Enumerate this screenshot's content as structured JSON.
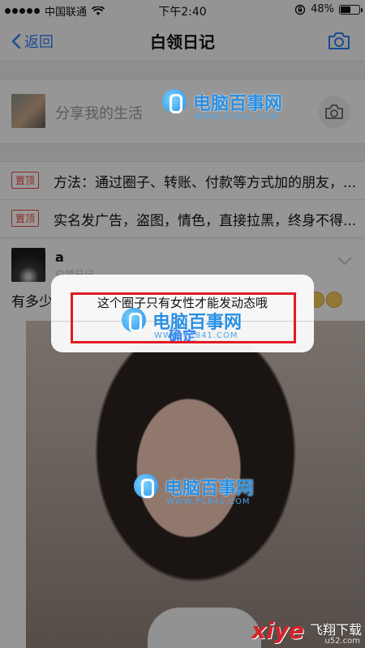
{
  "status_bar": {
    "carrier": "中国联通",
    "time": "下午2:40",
    "battery": "48%",
    "battery_level": 0.48
  },
  "nav": {
    "back_label": "返回",
    "title": "白领日记",
    "camera_icon": "camera-icon"
  },
  "share": {
    "placeholder": "分享我的生活",
    "camera_icon": "camera-icon"
  },
  "pinned": [
    {
      "badge": "置顶",
      "text": "方法：通过圈子、转账、付款等方式加的朋友，..."
    },
    {
      "badge": "置顶",
      "text": "实名发广告，盗图，情色，直接拉黑，终身不得..."
    }
  ],
  "post": {
    "author": "a",
    "subtitle": "白领日记",
    "text": "有多少"
  },
  "alert": {
    "message": "这个圈子只有女性才能发动态哦",
    "confirm_label": "确定"
  },
  "watermark": {
    "title": "电脑百事网",
    "url": "WWW.PC841.COM"
  },
  "bottom_watermark": {
    "brand": "xiye",
    "text": "飞翔下载",
    "url": "u52.com"
  },
  "colors": {
    "accent": "#2f7ff2",
    "pin_red": "#e8473d",
    "highlight": "#e11b22"
  }
}
